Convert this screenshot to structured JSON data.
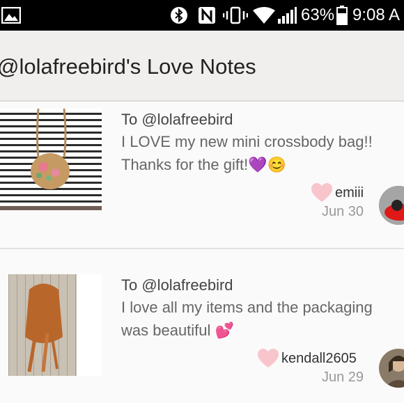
{
  "status_bar": {
    "icons": [
      "image-icon",
      "bluetooth-icon",
      "nfc-icon",
      "vibrate-icon",
      "wifi-icon",
      "signal-icon",
      "battery-icon"
    ],
    "battery_percent": "63%",
    "time": "9:08 A"
  },
  "header": {
    "title": "@lolafreebird's Love Notes"
  },
  "notes": [
    {
      "to": "To @lolafreebird",
      "message_line1": "I LOVE my new mini crossbody bag!!",
      "message_line2": "Thanks for the gift!💜😊",
      "username": "emiii",
      "date": "Jun 30"
    },
    {
      "to": "To @lolafreebird",
      "message_line1": "I love all my items and the packaging",
      "message_line2": "was beautiful 💕",
      "username": "kendall2605",
      "date": "Jun 29"
    }
  ],
  "colors": {
    "heart": "#f7c5cb",
    "header_bg": "#f1efed",
    "status_bar_bg": "#000000"
  }
}
